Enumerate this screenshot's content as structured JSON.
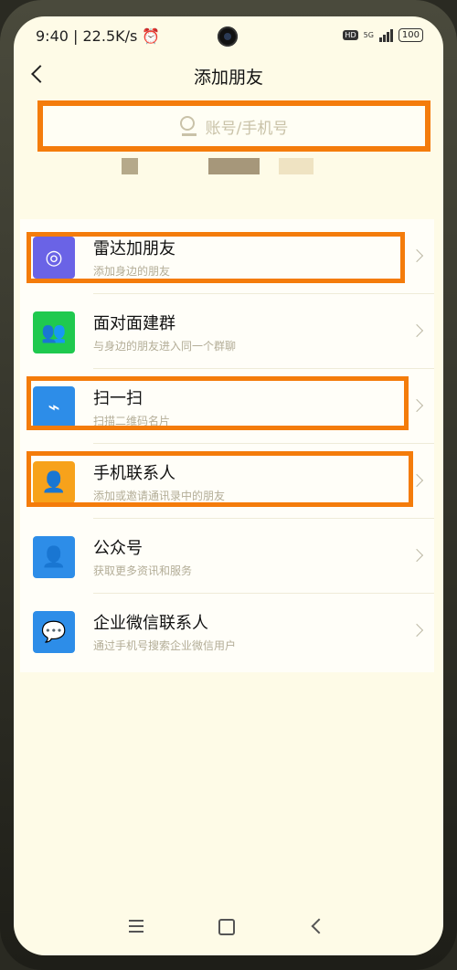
{
  "status": {
    "time": "9:40 | 22.5K/s ⏰",
    "hd": "HD",
    "network": "5G",
    "battery": "100"
  },
  "header": {
    "title": "添加朋友"
  },
  "search": {
    "placeholder": "账号/手机号"
  },
  "items": [
    {
      "title": "雷达加朋友",
      "subtitle": "添加身边的朋友",
      "icon": "radar-icon",
      "color": "#6a63e6"
    },
    {
      "title": "面对面建群",
      "subtitle": "与身边的朋友进入同一个群聊",
      "icon": "group-face-icon",
      "color": "#1fc94f"
    },
    {
      "title": "扫一扫",
      "subtitle": "扫描二维码名片",
      "icon": "scan-icon",
      "color": "#2d8de8"
    },
    {
      "title": "手机联系人",
      "subtitle": "添加或邀请通讯录中的朋友",
      "icon": "phone-contacts-icon",
      "color": "#f7a21b"
    },
    {
      "title": "公众号",
      "subtitle": "获取更多资讯和服务",
      "icon": "official-account-icon",
      "color": "#2d8de8"
    },
    {
      "title": "企业微信联系人",
      "subtitle": "通过手机号搜索企业微信用户",
      "icon": "work-wechat-icon",
      "color": "#2d8de8"
    }
  ],
  "colors": {
    "highlight": "#f47c0b",
    "background": "#fefbe7"
  }
}
